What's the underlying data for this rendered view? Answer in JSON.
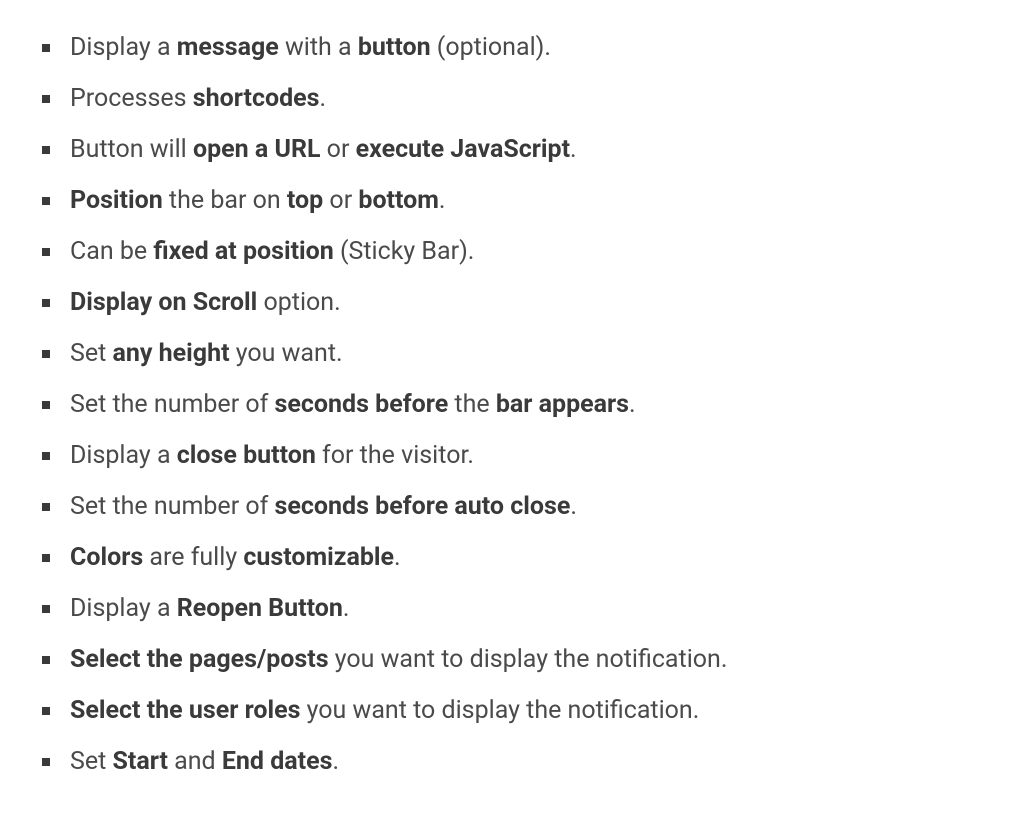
{
  "features": [
    {
      "segments": [
        {
          "text": "Display a ",
          "bold": false
        },
        {
          "text": "message",
          "bold": true
        },
        {
          "text": " with a ",
          "bold": false
        },
        {
          "text": "button",
          "bold": true
        },
        {
          "text": " (optional).",
          "bold": false
        }
      ]
    },
    {
      "segments": [
        {
          "text": "Processes ",
          "bold": false
        },
        {
          "text": "shortcodes",
          "bold": true
        },
        {
          "text": ".",
          "bold": false
        }
      ]
    },
    {
      "segments": [
        {
          "text": "Button will ",
          "bold": false
        },
        {
          "text": "open a URL",
          "bold": true
        },
        {
          "text": " or ",
          "bold": false
        },
        {
          "text": "execute JavaScript",
          "bold": true
        },
        {
          "text": ".",
          "bold": false
        }
      ]
    },
    {
      "segments": [
        {
          "text": "Position",
          "bold": true
        },
        {
          "text": " the bar on ",
          "bold": false
        },
        {
          "text": "top",
          "bold": true
        },
        {
          "text": " or ",
          "bold": false
        },
        {
          "text": "bottom",
          "bold": true
        },
        {
          "text": ".",
          "bold": false
        }
      ]
    },
    {
      "segments": [
        {
          "text": "Can be ",
          "bold": false
        },
        {
          "text": "fixed at position",
          "bold": true
        },
        {
          "text": " (Sticky Bar).",
          "bold": false
        }
      ]
    },
    {
      "segments": [
        {
          "text": "Display on Scroll",
          "bold": true
        },
        {
          "text": " option.",
          "bold": false
        }
      ]
    },
    {
      "segments": [
        {
          "text": "Set ",
          "bold": false
        },
        {
          "text": "any height",
          "bold": true
        },
        {
          "text": " you want.",
          "bold": false
        }
      ]
    },
    {
      "segments": [
        {
          "text": "Set the number of ",
          "bold": false
        },
        {
          "text": "seconds before",
          "bold": true
        },
        {
          "text": " the ",
          "bold": false
        },
        {
          "text": "bar appears",
          "bold": true
        },
        {
          "text": ".",
          "bold": false
        }
      ]
    },
    {
      "segments": [
        {
          "text": "Display a ",
          "bold": false
        },
        {
          "text": "close button",
          "bold": true
        },
        {
          "text": " for the visitor.",
          "bold": false
        }
      ]
    },
    {
      "segments": [
        {
          "text": "Set the number of ",
          "bold": false
        },
        {
          "text": "seconds before auto close",
          "bold": true
        },
        {
          "text": ".",
          "bold": false
        }
      ]
    },
    {
      "segments": [
        {
          "text": "Colors",
          "bold": true
        },
        {
          "text": " are fully ",
          "bold": false
        },
        {
          "text": "customizable",
          "bold": true
        },
        {
          "text": ".",
          "bold": false
        }
      ]
    },
    {
      "segments": [
        {
          "text": "Display a ",
          "bold": false
        },
        {
          "text": "Reopen Button",
          "bold": true
        },
        {
          "text": ".",
          "bold": false
        }
      ]
    },
    {
      "segments": [
        {
          "text": "Select the pages/posts",
          "bold": true
        },
        {
          "text": " you want to display the notification.",
          "bold": false
        }
      ]
    },
    {
      "segments": [
        {
          "text": "Select the user roles",
          "bold": true
        },
        {
          "text": " you want to display the notification.",
          "bold": false
        }
      ]
    },
    {
      "segments": [
        {
          "text": "Set ",
          "bold": false
        },
        {
          "text": "Start",
          "bold": true
        },
        {
          "text": " and ",
          "bold": false
        },
        {
          "text": "End dates",
          "bold": true
        },
        {
          "text": ".",
          "bold": false
        }
      ]
    }
  ]
}
